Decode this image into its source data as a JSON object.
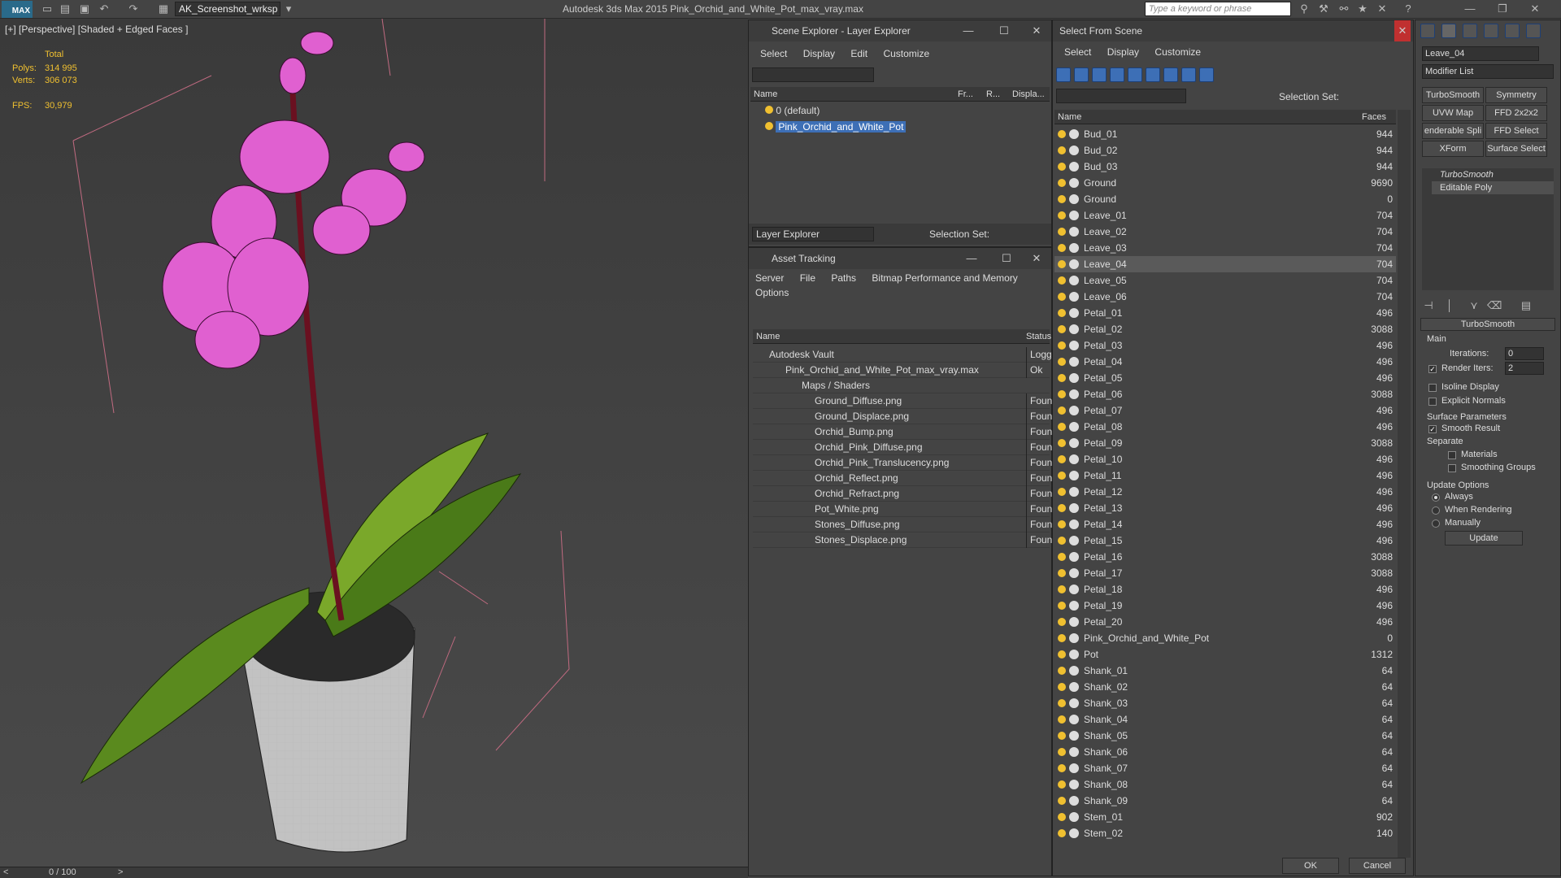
{
  "topbar": {
    "logo": "MAX",
    "workspace": "AK_Screenshot_wrksp",
    "title": "Autodesk 3ds Max  2015     Pink_Orchid_and_White_Pot_max_vray.max",
    "search_placeholder": "Type a keyword or phrase"
  },
  "viewport": {
    "label": "[+] [Perspective] [Shaded + Edged Faces ]",
    "stats": {
      "total_label": "Total",
      "polys_label": "Polys:",
      "polys": "314 995",
      "verts_label": "Verts:",
      "verts": "306 073",
      "fps_label": "FPS:",
      "fps": "30,979"
    },
    "time": "0 / 100"
  },
  "scene_explorer": {
    "title": "Scene Explorer - Layer Explorer",
    "menus": [
      "Select",
      "Display",
      "Edit",
      "Customize"
    ],
    "columns": [
      "Name",
      "Fr...",
      "R...",
      "Displa..."
    ],
    "rows": [
      "0 (default)",
      "Pink_Orchid_and_White_Pot"
    ],
    "footer_label": "Layer Explorer",
    "selection_set": "Selection Set:"
  },
  "asset_tracking": {
    "title": "Asset Tracking",
    "menus": [
      "Server",
      "File",
      "Paths",
      "Bitmap Performance and Memory"
    ],
    "menu2": "Options",
    "columns": [
      "Name",
      "Status"
    ],
    "rows": [
      {
        "name": "Autodesk Vault",
        "status": "Logge"
      },
      {
        "name": "Pink_Orchid_and_White_Pot_max_vray.max",
        "status": "Ok"
      },
      {
        "name": "Maps / Shaders",
        "status": ""
      },
      {
        "name": "Ground_Diffuse.png",
        "status": "Found"
      },
      {
        "name": "Ground_Displace.png",
        "status": "Found"
      },
      {
        "name": "Orchid_Bump.png",
        "status": "Found"
      },
      {
        "name": "Orchid_Pink_Diffuse.png",
        "status": "Found"
      },
      {
        "name": "Orchid_Pink_Translucency.png",
        "status": "Found"
      },
      {
        "name": "Orchid_Reflect.png",
        "status": "Found"
      },
      {
        "name": "Orchid_Refract.png",
        "status": "Found"
      },
      {
        "name": "Pot_White.png",
        "status": "Found"
      },
      {
        "name": "Stones_Diffuse.png",
        "status": "Found"
      },
      {
        "name": "Stones_Displace.png",
        "status": "Found"
      }
    ]
  },
  "select_from_scene": {
    "title": "Select From Scene",
    "menus": [
      "Select",
      "Display",
      "Customize"
    ],
    "selection_set": "Selection Set:",
    "columns": [
      "Name",
      "Faces"
    ],
    "rows": [
      [
        "Bud_01",
        "944"
      ],
      [
        "Bud_02",
        "944"
      ],
      [
        "Bud_03",
        "944"
      ],
      [
        "Ground",
        "9690"
      ],
      [
        "Ground",
        "0"
      ],
      [
        "Leave_01",
        "704"
      ],
      [
        "Leave_02",
        "704"
      ],
      [
        "Leave_03",
        "704"
      ],
      [
        "Leave_04",
        "704"
      ],
      [
        "Leave_05",
        "704"
      ],
      [
        "Leave_06",
        "704"
      ],
      [
        "Petal_01",
        "496"
      ],
      [
        "Petal_02",
        "3088"
      ],
      [
        "Petal_03",
        "496"
      ],
      [
        "Petal_04",
        "496"
      ],
      [
        "Petal_05",
        "496"
      ],
      [
        "Petal_06",
        "3088"
      ],
      [
        "Petal_07",
        "496"
      ],
      [
        "Petal_08",
        "496"
      ],
      [
        "Petal_09",
        "3088"
      ],
      [
        "Petal_10",
        "496"
      ],
      [
        "Petal_11",
        "496"
      ],
      [
        "Petal_12",
        "496"
      ],
      [
        "Petal_13",
        "496"
      ],
      [
        "Petal_14",
        "496"
      ],
      [
        "Petal_15",
        "496"
      ],
      [
        "Petal_16",
        "3088"
      ],
      [
        "Petal_17",
        "3088"
      ],
      [
        "Petal_18",
        "496"
      ],
      [
        "Petal_19",
        "496"
      ],
      [
        "Petal_20",
        "496"
      ],
      [
        "Pink_Orchid_and_White_Pot",
        "0"
      ],
      [
        "Pot",
        "1312"
      ],
      [
        "Shank_01",
        "64"
      ],
      [
        "Shank_02",
        "64"
      ],
      [
        "Shank_03",
        "64"
      ],
      [
        "Shank_04",
        "64"
      ],
      [
        "Shank_05",
        "64"
      ],
      [
        "Shank_06",
        "64"
      ],
      [
        "Shank_07",
        "64"
      ],
      [
        "Shank_08",
        "64"
      ],
      [
        "Shank_09",
        "64"
      ],
      [
        "Stem_01",
        "902"
      ],
      [
        "Stem_02",
        "140"
      ]
    ],
    "ok": "OK",
    "cancel": "Cancel"
  },
  "command_panel": {
    "object_name": "Leave_04",
    "modifier_list": "Modifier List",
    "buttons": [
      "TurboSmooth",
      "Symmetry",
      "UVW Map",
      "FFD 2x2x2",
      "enderable Spli",
      "FFD Select",
      "XForm",
      "Surface Select"
    ],
    "stack": [
      "TurboSmooth",
      "Editable Poly"
    ],
    "rollout": {
      "title": "TurboSmooth",
      "main": "Main",
      "iterations_label": "Iterations:",
      "iterations": "0",
      "render_iters_label": "Render Iters:",
      "render_iters": "2",
      "isoline": "Isoline Display",
      "explicit": "Explicit Normals",
      "surface": "Surface Parameters",
      "smooth": "Smooth Result",
      "separate": "Separate",
      "materials": "Materials",
      "smoothing": "Smoothing Groups",
      "update_options": "Update Options",
      "always": "Always",
      "when_rendering": "When Rendering",
      "manually": "Manually",
      "update": "Update"
    }
  }
}
